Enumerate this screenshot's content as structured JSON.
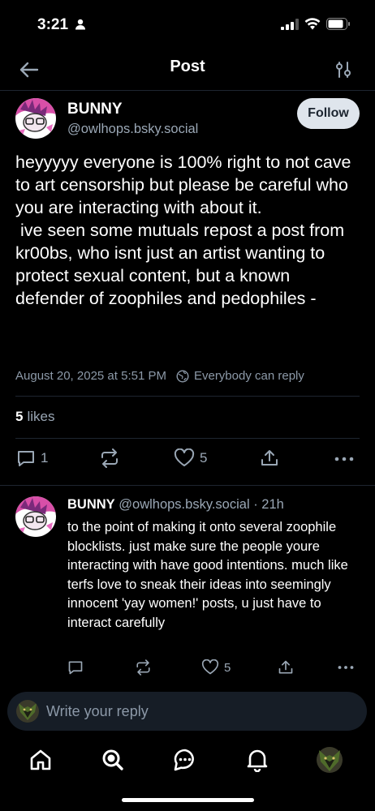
{
  "status": {
    "time": "3:21"
  },
  "header": {
    "title": "Post"
  },
  "post": {
    "author_name": "BUNNY",
    "author_handle": "@owlhops.bsky.social",
    "follow_label": "Follow",
    "text": "heyyyyy everyone is 100% right to not cave to art censorship but please be careful who you are interacting with about it.\n ive seen some mutuals repost a post from kr00bs, who isnt just an artist wanting to protect sexual content, but a known defender of zoophiles and pedophiles -",
    "timestamp": "August 20, 2025 at 5:51 PM",
    "reply_setting": "Everybody can reply",
    "likes_count": "5",
    "likes_label": "likes",
    "reply_count": "1",
    "like_count": "5"
  },
  "reply": {
    "author_name": "BUNNY",
    "author_handle": "@owlhops.bsky.social",
    "age": "· 21h",
    "text": "to the point of making it onto several zoophile blocklists. just make sure the people youre interacting with have good intentions. much like terfs love to sneak their ideas into seemingly innocent 'yay women!' posts, u just have to interact carefully",
    "like_count": "5"
  },
  "composer": {
    "placeholder": "Write your reply"
  },
  "colors": {
    "background": "#000000",
    "secondary_text": "#9aa7b5",
    "follow_bg": "#dfe5ec",
    "divider": "#1e2530"
  },
  "icons": [
    "person-icon",
    "signal-icon",
    "wifi-icon",
    "battery-icon",
    "back-arrow-icon",
    "filter-icon",
    "globe-icon",
    "reply-icon",
    "repost-icon",
    "heart-icon",
    "share-icon",
    "more-icon",
    "home-icon",
    "search-icon",
    "chat-icon",
    "bell-icon"
  ]
}
